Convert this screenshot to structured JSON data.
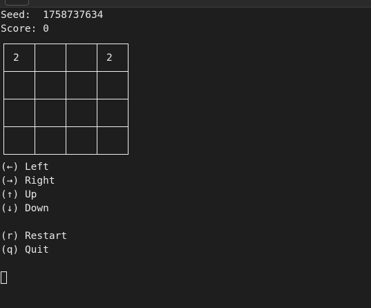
{
  "seed_label": "Seed:  ",
  "seed": "1758737634",
  "score_label": "Score: ",
  "score": "0",
  "board": [
    [
      "2",
      "",
      "",
      "2"
    ],
    [
      "",
      "",
      "",
      ""
    ],
    [
      "",
      "",
      "",
      ""
    ],
    [
      "",
      "",
      "",
      ""
    ]
  ],
  "controls": [
    {
      "key": "(←)",
      "label": "Left"
    },
    {
      "key": "(→)",
      "label": "Right"
    },
    {
      "key": "(↑)",
      "label": "Up"
    },
    {
      "key": "(↓)",
      "label": "Down"
    },
    {
      "key": "(r)",
      "label": "Restart"
    },
    {
      "key": "(q)",
      "label": "Quit"
    }
  ]
}
